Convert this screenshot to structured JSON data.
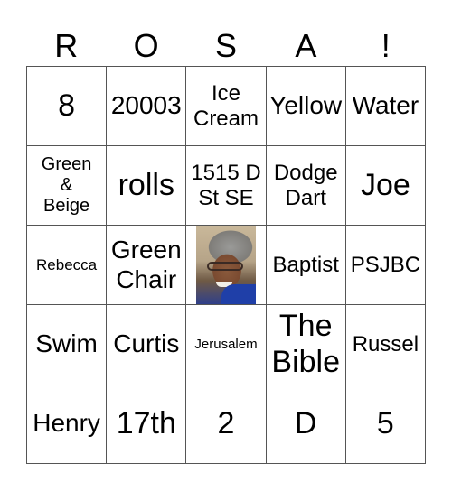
{
  "header": {
    "letters": [
      "R",
      "O",
      "S",
      "A",
      "!"
    ]
  },
  "board": {
    "rows": [
      [
        "8",
        "20003",
        "Ice\nCream",
        "Yellow",
        "Water"
      ],
      [
        "Green\n&\nBeige",
        "rolls",
        "1515 D\nSt SE",
        "Dodge\nDart",
        "Joe"
      ],
      [
        "Rebecca",
        "Green\nChair",
        "",
        "Baptist",
        "PSJBC"
      ],
      [
        "Swim",
        "Curtis",
        "Jerusalem",
        "The\nBible",
        "Russel"
      ],
      [
        "Henry",
        "17th",
        "2",
        "D",
        "5"
      ]
    ],
    "center_cell": {
      "type": "photo",
      "icon": "portrait-photo"
    }
  }
}
